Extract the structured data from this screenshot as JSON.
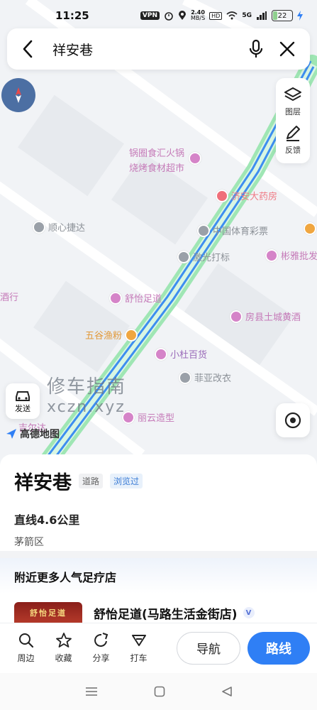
{
  "status_bar": {
    "time": "11:25",
    "vpn": "VPN",
    "net_speed": "2.40",
    "net_unit": "MB/S",
    "hd": "HD",
    "signal": "5G",
    "battery": "22"
  },
  "search": {
    "query": "祥安巷"
  },
  "map_tools": {
    "layers_label": "图层",
    "feedback_label": "反馈",
    "send_label": "发送",
    "logo_text": "高德地图"
  },
  "map_pois": [
    {
      "name": "锅圈食汇火锅",
      "name2": "烧烤食材超市",
      "color": "pink"
    },
    {
      "name": "济安大药房",
      "color": "red"
    },
    {
      "name": "顺心捷达",
      "color": "gray"
    },
    {
      "name": "中国体育彩票",
      "color": "gray"
    },
    {
      "name": "激光打标",
      "color": "gray"
    },
    {
      "name": "彬雅批发",
      "color": "pink"
    },
    {
      "name": "舒怡足道",
      "color": "pink"
    },
    {
      "name": "房县土城黄酒",
      "color": "pink"
    },
    {
      "name": "五谷渔粉",
      "color": "orange"
    },
    {
      "name": "小杜百货",
      "color": "pink"
    },
    {
      "name": "菲亚改衣",
      "color": "gray"
    },
    {
      "name": "丽云造型",
      "color": "pink"
    },
    {
      "name": "酒行",
      "color": "pink"
    },
    {
      "name": "吉尔达",
      "color": "gray"
    }
  ],
  "watermark": {
    "line1": "修车指南",
    "line2": "xczn.xyz"
  },
  "place": {
    "name": "祥安巷",
    "type_tag": "道路",
    "viewed_tag": "浏览过",
    "distance": "直线4.6公里",
    "district": "茅箭区"
  },
  "nearby": {
    "heading": "附近更多人气足疗店",
    "shop_name": "舒怡足道(马路生活金街店)",
    "shop_sign": "舒怡足道",
    "badge": "V"
  },
  "actions": {
    "nearby": "周边",
    "favorite": "收藏",
    "share": "分享",
    "taxi": "打车",
    "navigate": "导航",
    "route": "路线"
  },
  "colors": {
    "accent": "#2f7ff5",
    "route_line": "#3d8ef0",
    "route_glow": "#8fe0a8"
  }
}
